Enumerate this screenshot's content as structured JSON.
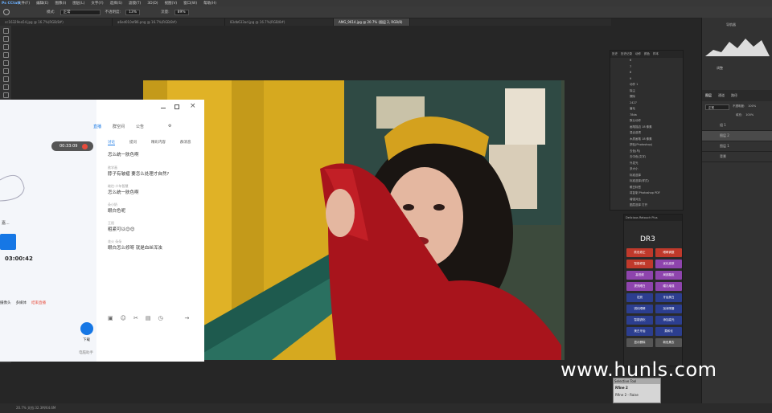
{
  "menubar": {
    "logo": "Ps CCtalk",
    "items": [
      "文件(F)",
      "编辑(E)",
      "图像(I)",
      "图层(L)",
      "文字(Y)",
      "选择(S)",
      "滤镜(T)",
      "3D(D)",
      "视图(V)",
      "窗口(W)",
      "帮助(H)"
    ]
  },
  "options": {
    "mode_label": "模式:",
    "mode_value": "正常",
    "opacity_label": "不透明度:",
    "opacity_value": "13%",
    "flow_label": "流量:",
    "flow_value": "89%"
  },
  "tabs": [
    "cc16329ea54.jpg @ 16.7%(RGB/8#)",
    "a6ed010ef86.png @ 16.7%(RGB/8#)",
    "83db633ad.jpg @ 16.7%(RGB/8#)",
    "AMG_9614.jpg @ 20.7% (图层 2, RGB/8)"
  ],
  "chat": {
    "timer": "00:33:09",
    "tabs": [
      "直播",
      "群空间",
      "公告"
    ],
    "subtabs": [
      "讨论",
      "提问",
      "精彩内容",
      "群消息"
    ],
    "messages": [
      {
        "name": "",
        "text": "怎么统一肤色啊"
      },
      {
        "name": "欲学画",
        "text": "脖子有皱褶 要怎么处理才自然?"
      },
      {
        "name": "继往-少年智慧",
        "text": "怎么统一肤色啊"
      },
      {
        "name": "朵小奶",
        "text": "眼白色呢"
      },
      {
        "name": "王阳",
        "text": "粗紧可以😊😊"
      },
      {
        "name": "花火 朵朵",
        "text": "眼白怎么修呀 就是血丝浑浊"
      }
    ],
    "left_text": "嘉...",
    "left_time": "03:00:42",
    "left_bottom": [
      "摄像头",
      "多媒体",
      "结束直播"
    ],
    "download_label": "下载",
    "bottom_link": "电脑助手"
  },
  "layers_panel": {
    "tabs": [
      "历史",
      "历史记录",
      "动作",
      "颜色",
      "样本"
    ],
    "items": [
      "6",
      "7",
      "8",
      "9",
      "动作 1",
      "除尘",
      "擦除",
      "2427",
      "眉毛",
      "78da",
      "默认动作",
      "画笔描边 18 像素",
      "混合选项",
      "木质画笔 18 像素",
      "拼贴(Photoshop)",
      "去色(鸟)",
      "去中色(文字)",
      "外发光",
      "多大小",
      "标准选择",
      "标准选择(样式)",
      "眼白标签",
      "将复制 Photoshop PDF",
      "增强对比",
      "图层选择 打开"
    ]
  },
  "plugin": {
    "title": "Delicious Retouch Plus",
    "logo": "DR3",
    "buttons": [
      {
        "label": "肤色修正",
        "color": "#c0392b"
      },
      {
        "label": "眼睛调整",
        "color": "#c0392b"
      },
      {
        "label": "智能修复",
        "color": "#c0392b"
      },
      {
        "label": "优化皮肤",
        "color": "#8e44ad"
      },
      {
        "label": "高低频",
        "color": "#8e44ad"
      },
      {
        "label": "局部磨皮",
        "color": "#8e44ad"
      },
      {
        "label": "提亮眼白",
        "color": "#8e44ad"
      },
      {
        "label": "瞳孔增强",
        "color": "#8e44ad"
      },
      {
        "label": "祛斑",
        "color": "#2c3e8f"
      },
      {
        "label": "牙齿美白",
        "color": "#2c3e8f"
      },
      {
        "label": "锐化眼睛",
        "color": "#2c3e8f"
      },
      {
        "label": "加深嘴唇",
        "color": "#2c3e8f"
      },
      {
        "label": "智能锐化",
        "color": "#2c3e8f"
      },
      {
        "label": "添加高光",
        "color": "#2c3e8f"
      },
      {
        "label": "美白牙齿",
        "color": "#2c3e8f"
      },
      {
        "label": "柔和化",
        "color": "#2c3e8f"
      },
      {
        "label": "显示删除",
        "color": "#555"
      },
      {
        "label": "新色素去",
        "color": "#555"
      }
    ]
  },
  "rpanel": {
    "nav_title": "导航器",
    "adj_title": "调整",
    "layers_tabs": [
      "图层",
      "通道",
      "路径"
    ],
    "blend": "正常",
    "opacity_label": "不透明度:",
    "opacity": "100%",
    "fill_label": "填充:",
    "fill": "100%",
    "layers": [
      "组 1",
      "图层 2",
      "图层 1",
      "背景"
    ]
  },
  "watermark": "www.hunls.com",
  "smallwin": {
    "title": "Selective Tool",
    "line1": "Rfine 2",
    "line2": "Rfine 2 - Raise"
  },
  "status": "20.7% 文档:32.3M/64.6M"
}
